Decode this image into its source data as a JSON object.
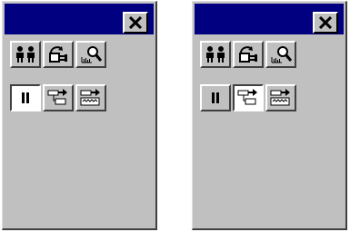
{
  "windows": [
    {
      "id": "left",
      "close_icon": "close-icon",
      "toolbar_row_1": [
        "users-icon",
        "plug-cycle-icon",
        "magnifier-chart-icon"
      ],
      "toolbar_row_2": [
        "pause-icon",
        "step-forward-icon",
        "step-over-icon"
      ],
      "pressed": "pause-button"
    },
    {
      "id": "right",
      "close_icon": "close-icon",
      "toolbar_row_1": [
        "users-icon",
        "plug-cycle-icon",
        "magnifier-chart-icon"
      ],
      "toolbar_row_2": [
        "pause-icon",
        "step-forward-icon",
        "step-over-icon"
      ],
      "pressed": "step-forward-button"
    }
  ],
  "colors": {
    "titlebar": "#000080",
    "face": "#c0c0c0",
    "pressed_face": "#ffffff"
  }
}
